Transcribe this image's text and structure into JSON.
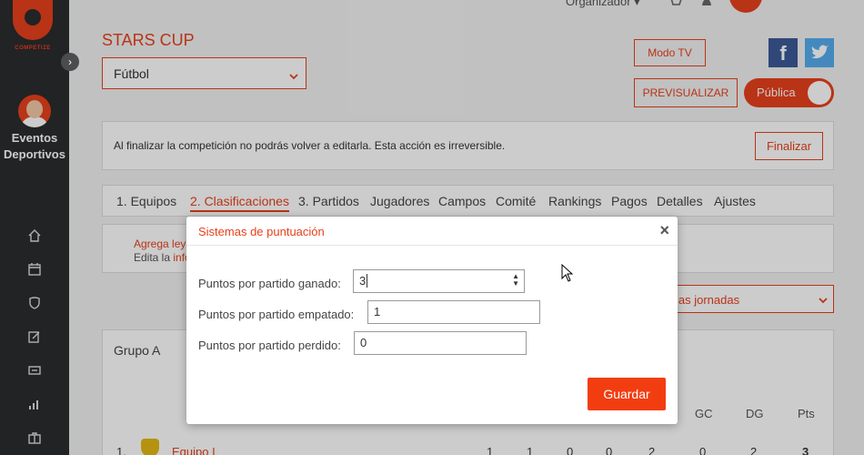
{
  "sidebar": {
    "logo_text": "COMPETIZE",
    "title_line1": "Eventos",
    "title_line2": "Deportivos",
    "icons": [
      "home-icon",
      "calendar-icon",
      "shield-icon",
      "edit-icon",
      "ticket-icon",
      "bar-chart-icon",
      "briefcase-icon"
    ]
  },
  "topbar": {
    "user_role": "Organizador"
  },
  "page": {
    "title": "STARS CUP",
    "sport_selected": "Fútbol",
    "btn_tv": "Modo TV",
    "btn_preview": "PREVISUALIZAR",
    "toggle_label": "Pública",
    "fb_letter": "f"
  },
  "notice": {
    "text": "Al finalizar la competición no podrás volver a editarla. Esta acción es irreversible.",
    "button": "Finalizar"
  },
  "tabs": [
    "1. Equipos",
    "2. Clasificaciones",
    "3. Partidos",
    "Jugadores",
    "Campos",
    "Comité",
    "Rankings",
    "Pagos",
    "Detalles",
    "Ajustes"
  ],
  "info": {
    "line1": "Agrega ley",
    "line2_prefix": "Edita la ",
    "line2_link": "info"
  },
  "rounds_select": "las jornadas",
  "group": {
    "title": "Grupo A",
    "columns": [
      "GC",
      "DG",
      "Pts"
    ],
    "row": {
      "position": "1.",
      "team": "Equipo I",
      "values": [
        "1",
        "1",
        "0",
        "0",
        "2",
        "0",
        "2",
        "3"
      ]
    }
  },
  "modal": {
    "title": "Sistemas de puntuación",
    "close": "×",
    "label_won": "Puntos por partido ganado:",
    "value_won": "3",
    "label_draw": "Puntos por partido empatado:",
    "value_draw": "1",
    "label_lost": "Puntos por partido perdido:",
    "value_lost": "0",
    "save": "Guardar"
  },
  "colors": {
    "accent": "#e8401c",
    "sidebar": "#2a2c2e",
    "facebook": "#3b5998",
    "twitter": "#55acee"
  }
}
